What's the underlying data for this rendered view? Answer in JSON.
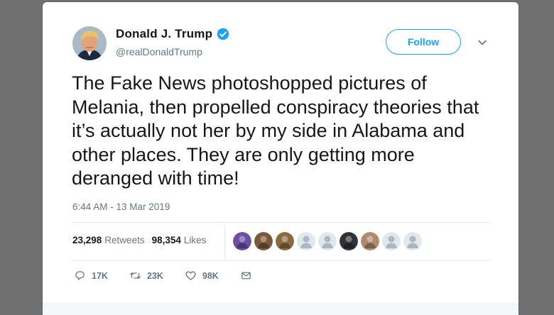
{
  "author": {
    "name": "Donald J. Trump",
    "handle": "@realDonaldTrump",
    "verified": true,
    "avatar_icon": "user-avatar-photo"
  },
  "follow_label": "Follow",
  "tweet": {
    "text": "The Fake News photoshopped pictures of Melania, then propelled conspiracy theories that it’s actually not her by my side in Alabama and other places. They are only getting more deranged with time!",
    "timestamp": "6:44 AM - 13 Mar 2019"
  },
  "stats": {
    "retweets_count": "23,298",
    "retweets_label": "Retweets",
    "likes_count": "98,354",
    "likes_label": "Likes"
  },
  "likers": [
    {
      "icon": "avatar-purple",
      "color": "#6b4fa0"
    },
    {
      "icon": "avatar-photo",
      "color": "#7a5a3a"
    },
    {
      "icon": "avatar-photo",
      "color": "#8a6a40"
    },
    {
      "icon": "default-avatar",
      "color": "#aab8c2"
    },
    {
      "icon": "default-avatar",
      "color": "#aab8c2"
    },
    {
      "icon": "avatar-photo",
      "color": "#2f3236"
    },
    {
      "icon": "avatar-photo",
      "color": "#b08a6e"
    },
    {
      "icon": "default-avatar",
      "color": "#aab8c2"
    },
    {
      "icon": "default-avatar",
      "color": "#aab8c2"
    }
  ],
  "actions": {
    "reply_count": "17K",
    "retweet_count": "23K",
    "like_count": "98K"
  },
  "colors": {
    "accent": "#1da1f2",
    "text": "#14171a",
    "secondary": "#657786",
    "background": "#707070"
  }
}
